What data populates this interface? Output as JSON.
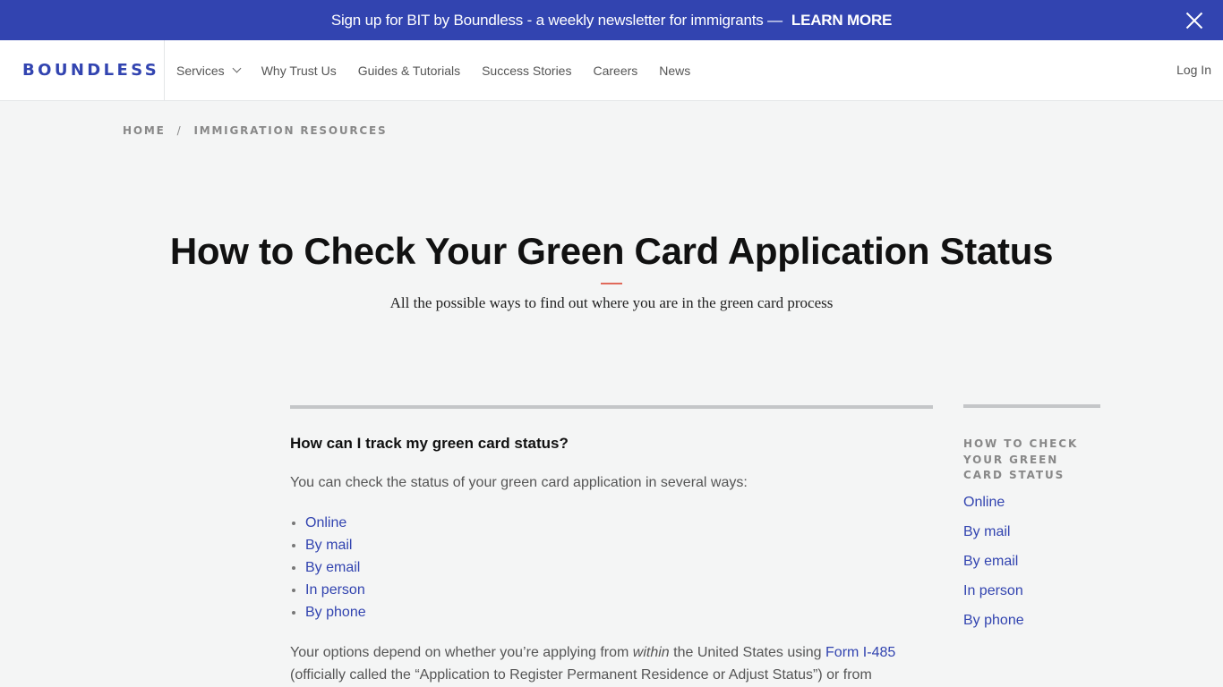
{
  "promo": {
    "text": "Sign up for BIT by Boundless - a weekly newsletter for immigrants —",
    "link": "LEARN MORE",
    "close_icon": "close-icon"
  },
  "header": {
    "logo": "BOUNDLESS",
    "nav": [
      {
        "label": "Services",
        "has_dropdown": true
      },
      {
        "label": "Why Trust Us"
      },
      {
        "label": "Guides & Tutorials"
      },
      {
        "label": "Success Stories"
      },
      {
        "label": "Careers"
      },
      {
        "label": "News"
      }
    ],
    "login": "Log In"
  },
  "breadcrumb": {
    "items": [
      "HOME",
      "IMMIGRATION RESOURCES"
    ],
    "separator": "/"
  },
  "page": {
    "title": "How to Check Your Green Card Application Status",
    "subtitle": "All the possible ways to find out where you are in the green card process"
  },
  "article": {
    "heading": "How can I track my green card status?",
    "intro": "You can check the status of your green card application in several ways:",
    "ways": [
      "Online",
      "By mail",
      "By email",
      "In person",
      "By phone"
    ],
    "options_before": "Your options depend on whether you’re applying from ",
    "options_em": "within",
    "options_middle": " the United States using ",
    "options_link": "Form I-485",
    "options_after": " (officially called the “Application to Register Permanent Residence or Adjust Status”) or from"
  },
  "toc": {
    "heading": "HOW TO CHECK YOUR GREEN CARD STATUS",
    "items": [
      "Online",
      "By mail",
      "By email",
      "In person",
      "By phone"
    ]
  },
  "colors": {
    "brand": "#3244b0",
    "accent_rule": "#e0695a",
    "background": "#f4f5f5"
  }
}
